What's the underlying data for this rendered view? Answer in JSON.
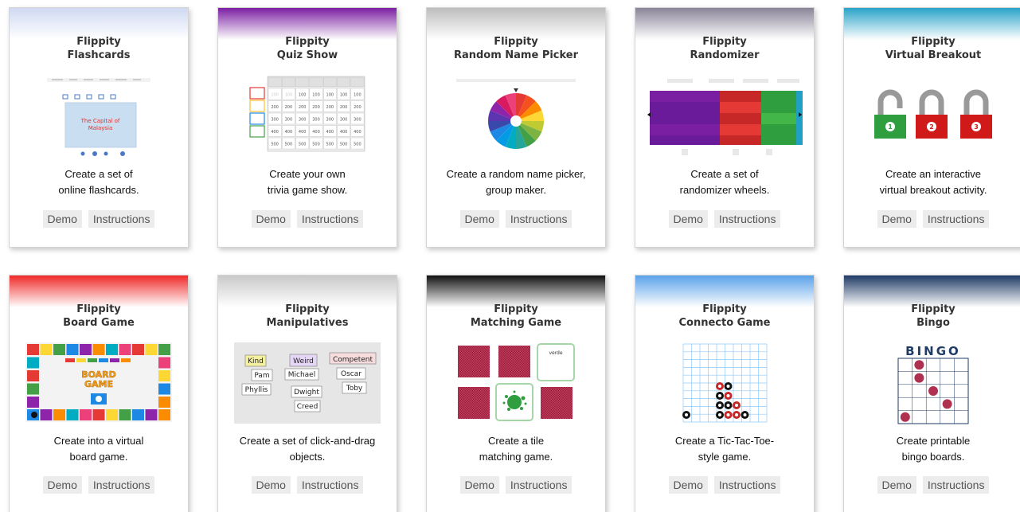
{
  "cards": [
    {
      "brand": "Flippity",
      "name": "Flashcards",
      "desc1": "Create a set of",
      "desc2": "online flashcards.",
      "demo": "Demo",
      "instructions": "Instructions",
      "thumb_text": "The Capital of Malaysia"
    },
    {
      "brand": "Flippity",
      "name": "Quiz Show",
      "desc1": "Create your own",
      "desc2": "trivia game show.",
      "demo": "Demo",
      "instructions": "Instructions"
    },
    {
      "brand": "Flippity",
      "name": "Random Name Picker",
      "desc1": "Create a random name picker,",
      "desc2": "group maker.",
      "demo": "Demo",
      "instructions": "Instructions"
    },
    {
      "brand": "Flippity",
      "name": "Randomizer",
      "desc1": "Create a set of",
      "desc2": "randomizer wheels.",
      "demo": "Demo",
      "instructions": "Instructions"
    },
    {
      "brand": "Flippity",
      "name": "Virtual Breakout",
      "desc1": "Create an interactive",
      "desc2": "virtual breakout activity.",
      "demo": "Demo",
      "instructions": "Instructions"
    },
    {
      "brand": "Flippity",
      "name": "Board Game",
      "desc1": "Create into a virtual",
      "desc2": "board game.",
      "demo": "Demo",
      "instructions": "Instructions",
      "thumb_text1": "BOARD",
      "thumb_text2": "GAME"
    },
    {
      "brand": "Flippity",
      "name": "Manipulatives",
      "desc1": "Create a set of click-and-drag",
      "desc2": "objects.",
      "demo": "Demo",
      "instructions": "Instructions",
      "words": [
        "Kind",
        "Weird",
        "Competent",
        "Pam",
        "Michael",
        "Oscar",
        "Phyllis",
        "Dwight",
        "Toby",
        "Creed"
      ]
    },
    {
      "brand": "Flippity",
      "name": "Matching Game",
      "desc1": "Create a tile",
      "desc2": "matching game.",
      "demo": "Demo",
      "instructions": "Instructions",
      "thumb_text": "verde"
    },
    {
      "brand": "Flippity",
      "name": "Connecto Game",
      "desc1": "Create a Tic-Tac-Toe-",
      "desc2": "style game.",
      "demo": "Demo",
      "instructions": "Instructions"
    },
    {
      "brand": "Flippity",
      "name": "Bingo",
      "desc1": "Create printable",
      "desc2": "bingo boards.",
      "demo": "Demo",
      "instructions": "Instructions",
      "thumb_title": "BINGO"
    }
  ],
  "band_colors": [
    "#cfd9f2",
    "#7b1fa2",
    "#bdbdbd",
    "#8a8599",
    "#29a3c9",
    "#f02a2a",
    "#c9c9c9",
    "#111111",
    "#5aa2ea",
    "#1f3b66"
  ]
}
